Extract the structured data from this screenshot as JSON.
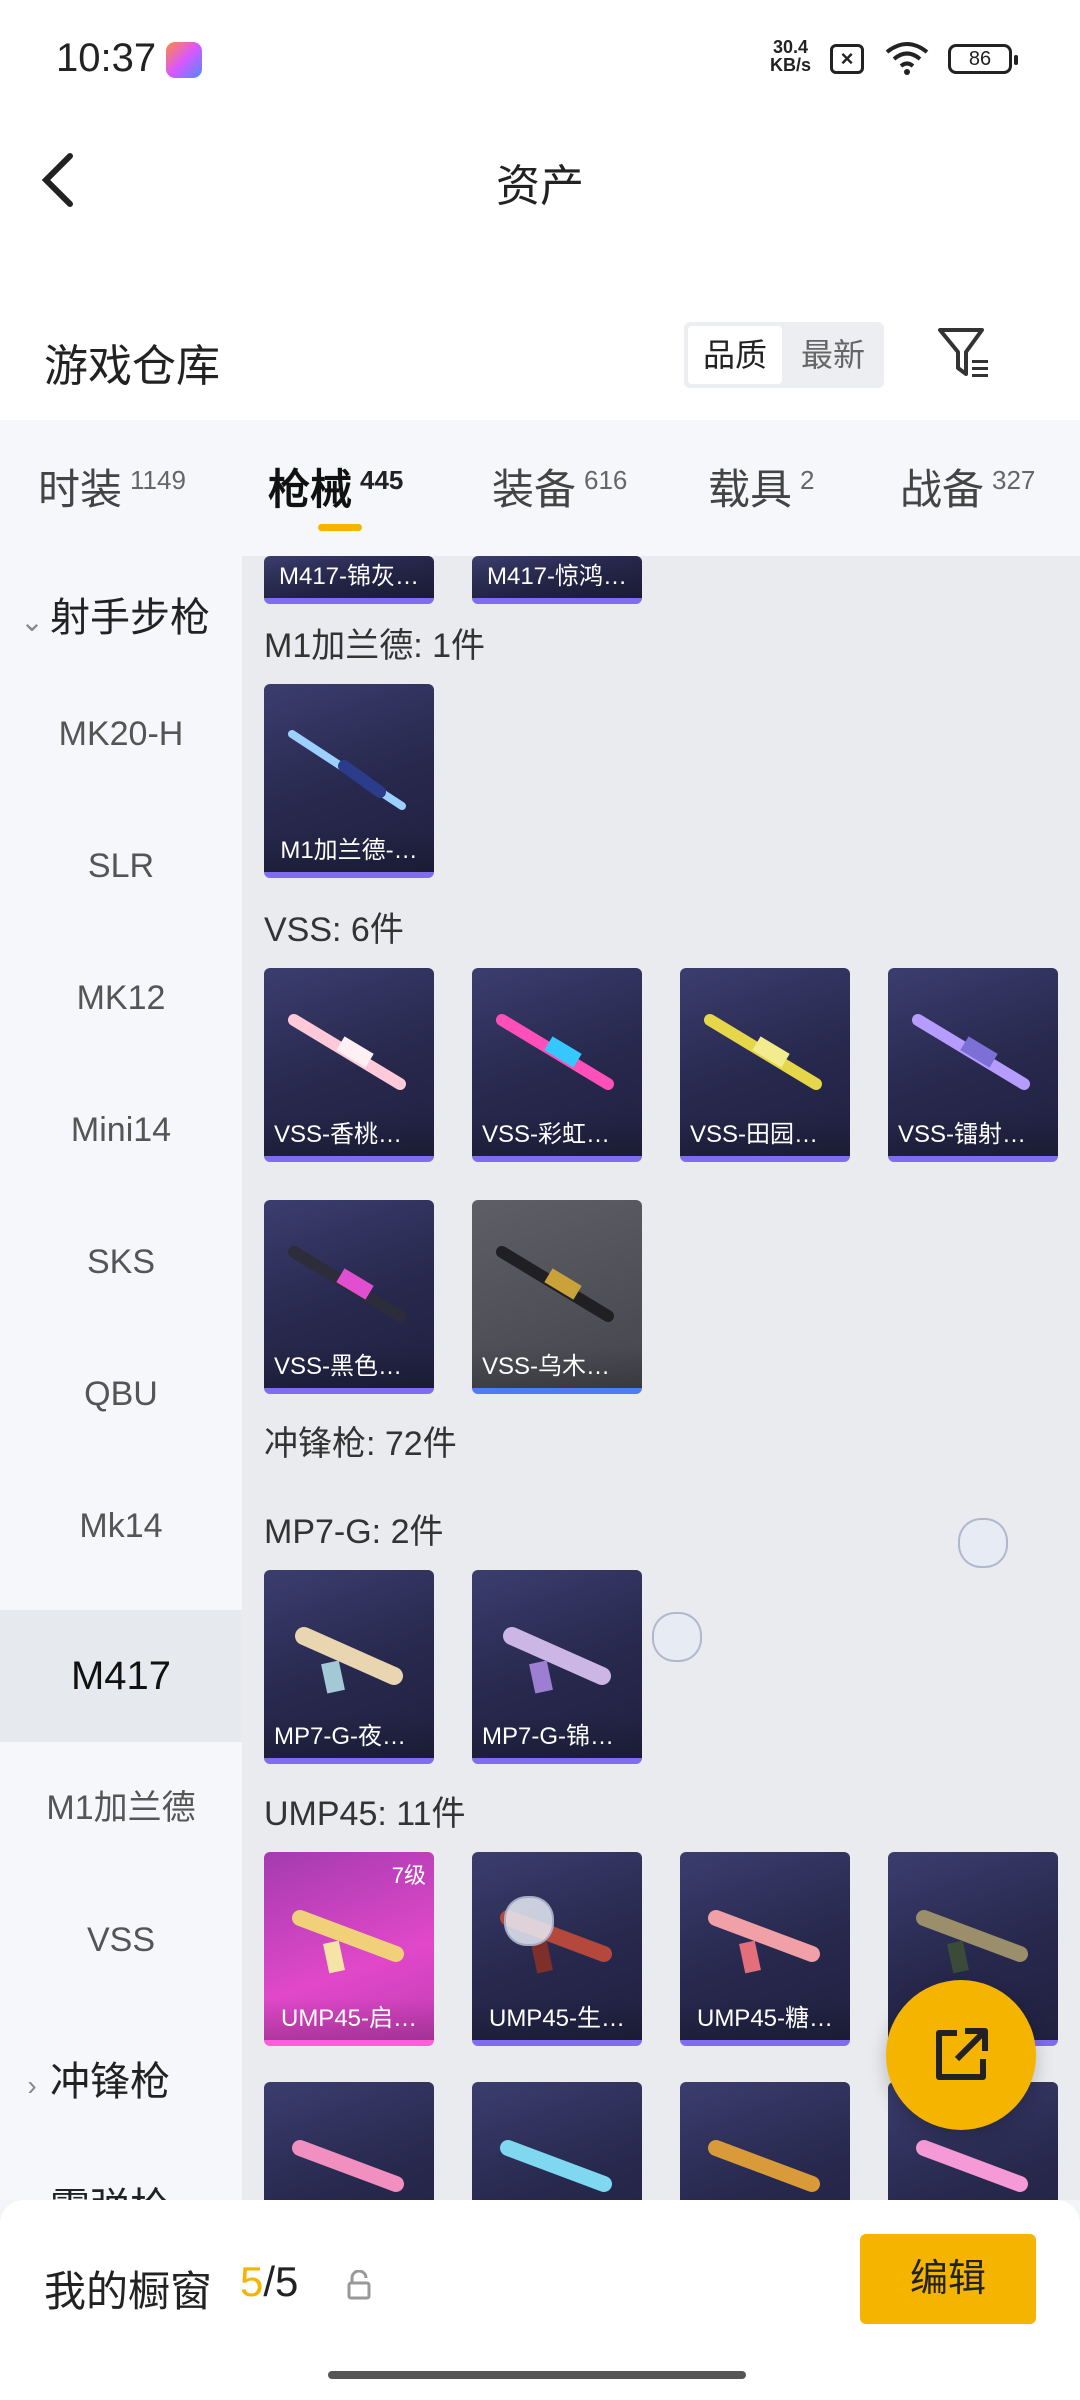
{
  "status_bar": {
    "time": "10:37",
    "net_speed_value": "30.4",
    "net_speed_unit": "KB/s",
    "battery": "86"
  },
  "header": {
    "title": "资产"
  },
  "warehouse": {
    "title": "游戏仓库",
    "sort_options": [
      "品质",
      "最新"
    ],
    "selected_sort": "品质"
  },
  "tabs": [
    {
      "label": "时装",
      "count": "1149"
    },
    {
      "label": "枪械",
      "count": "445",
      "active": true
    },
    {
      "label": "装备",
      "count": "616"
    },
    {
      "label": "载具",
      "count": "2"
    },
    {
      "label": "战备",
      "count": "327"
    }
  ],
  "sidebar": {
    "group_expanded": "射手步枪",
    "items": [
      "MK20-H",
      "SLR",
      "MK12",
      "Mini14",
      "SKS",
      "QBU",
      "Mk14",
      "M417",
      "M1加兰德",
      "VSS"
    ],
    "active_item": "M417",
    "group_collapsed_1": "冲锋枪",
    "group_collapsed_2": "霰弹枪"
  },
  "content": {
    "top_partial_cards": [
      "M417-锦灰…",
      "M417-惊鸿…"
    ],
    "m1_title": "M1加兰德: 1件",
    "m1_cards": [
      "M1加兰德-…"
    ],
    "vss_title": "VSS: 6件",
    "vss_cards": [
      "VSS-香桃花海",
      "VSS-彩虹符号",
      "VSS-田园牧歌",
      "VSS-镭射皇者",
      "VSS-黑色刀锋",
      "VSS-乌木金纹"
    ],
    "smg_title": "冲锋枪: 72件",
    "mp7_title": "MP7-G: 2件",
    "mp7_cards": [
      "MP7-G-夜鸢…",
      "MP7-G-锦灰…"
    ],
    "ump_title": "UMP45: 11件",
    "ump_cards": [
      "UMP45-启…",
      "UMP45-生…",
      "UMP45-糖…"
    ],
    "ump_first_level": "7级"
  },
  "bottom_bar": {
    "showcase_label": "我的橱窗",
    "showcase_current": "5",
    "showcase_total": "/5",
    "edit_label": "编辑"
  },
  "colors": {
    "accent": "#f4b400",
    "card_bg": "#27284d",
    "card_border": "#7f6cf0"
  }
}
